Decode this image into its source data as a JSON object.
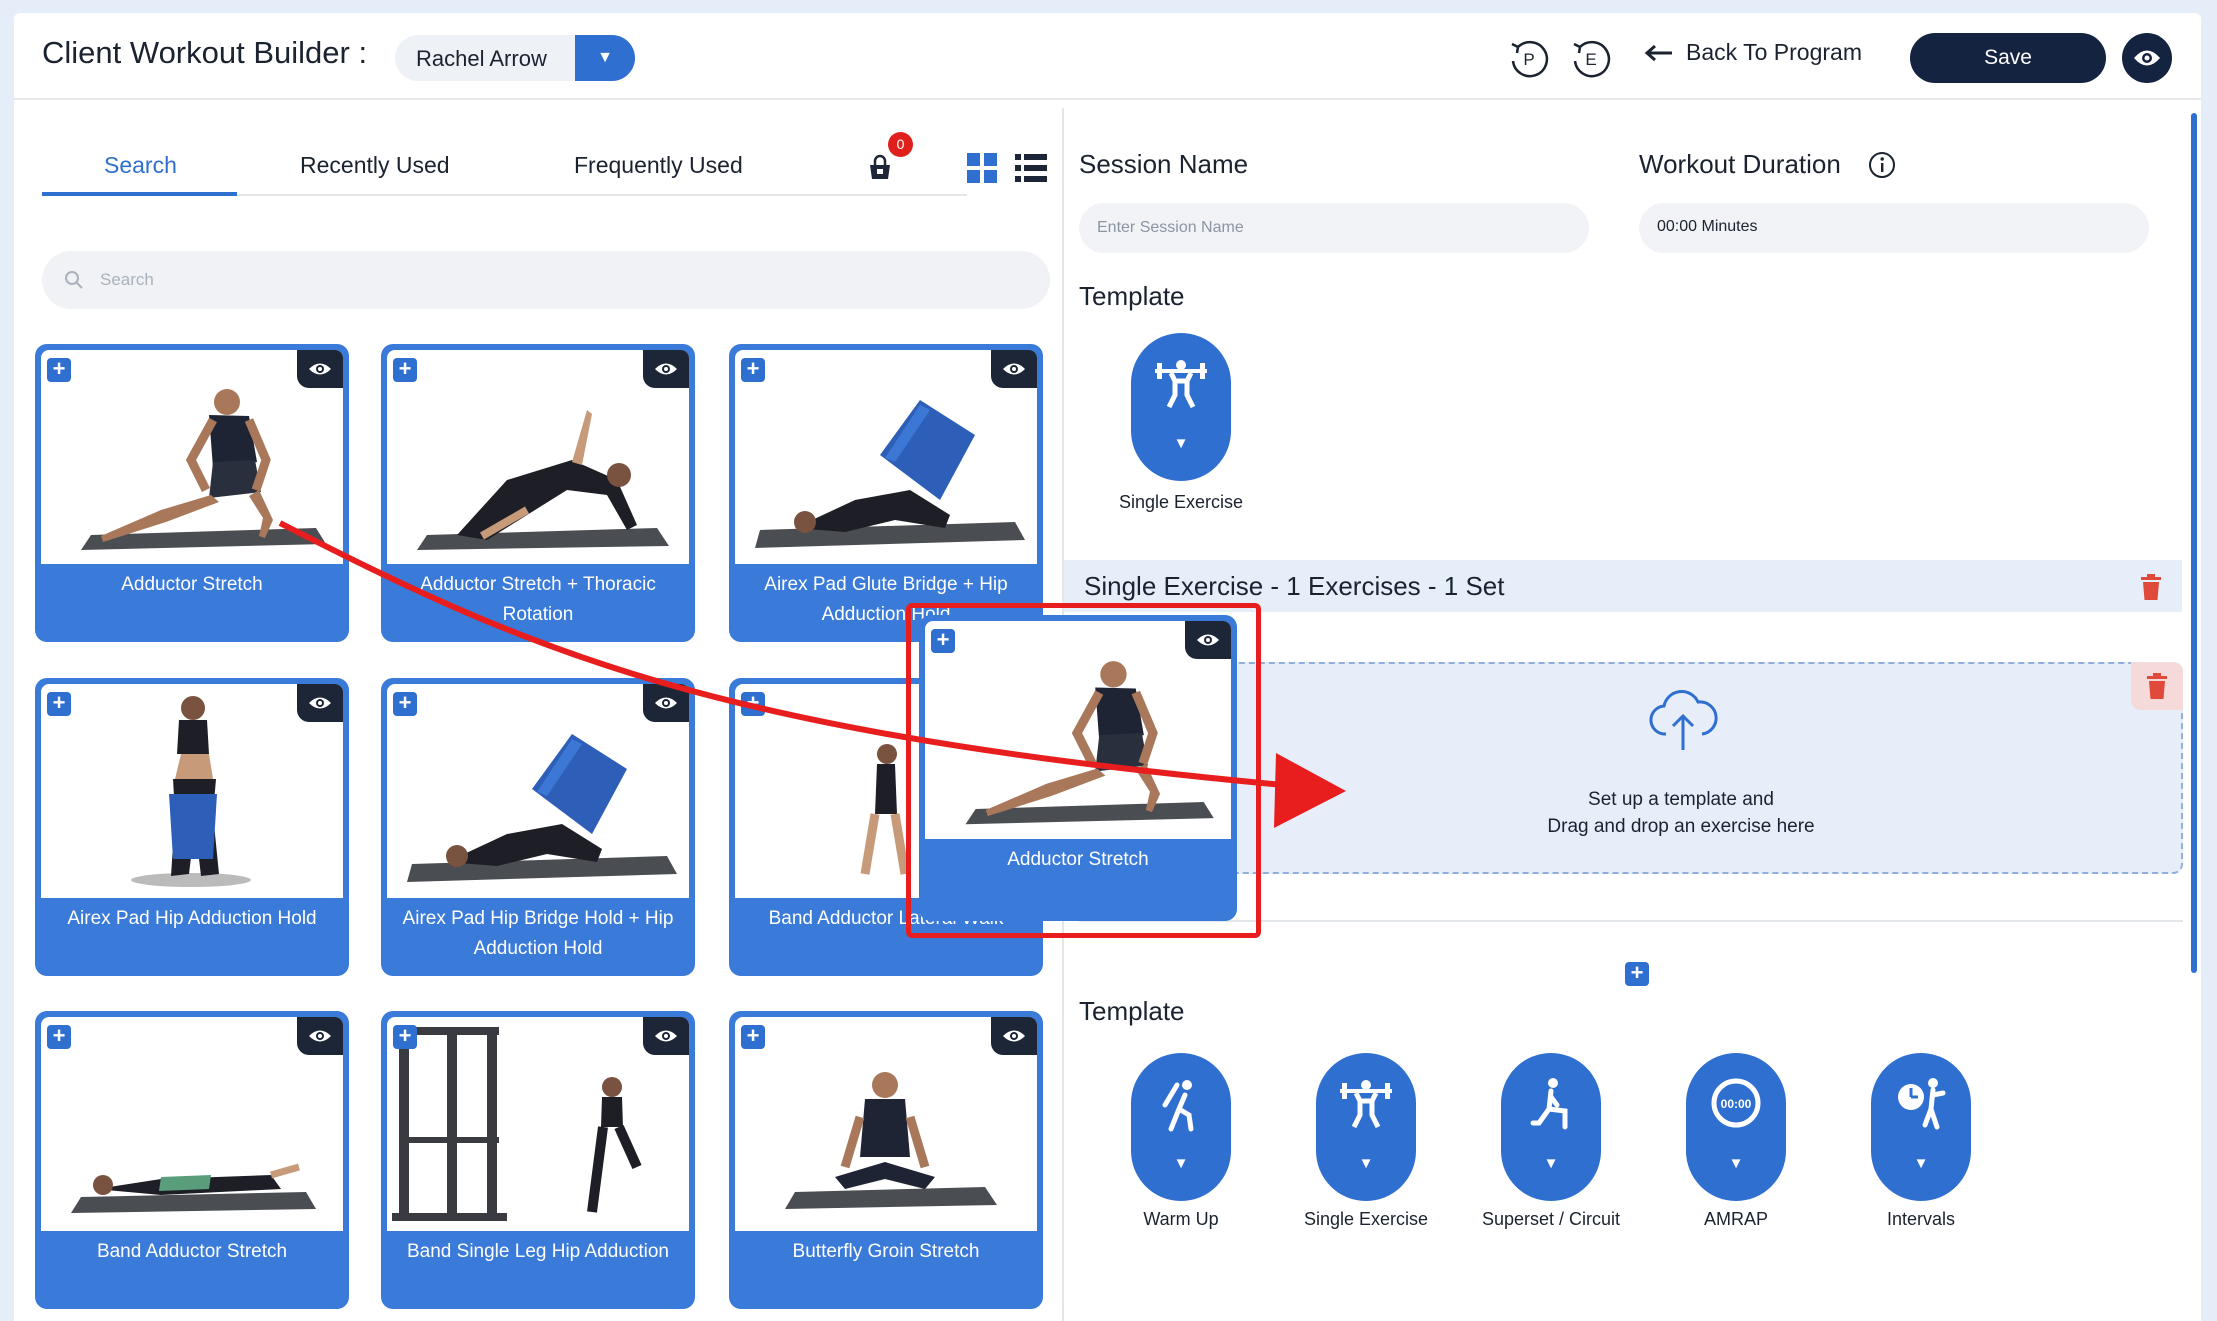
{
  "header": {
    "title": "Client Workout Builder :",
    "client_name": "Rachel Arrow",
    "undo_p": "P",
    "undo_e": "E",
    "back_label": "Back To Program",
    "save_label": "Save"
  },
  "library": {
    "tabs": [
      "Search",
      "Recently Used",
      "Frequently Used"
    ],
    "active_tab": "Search",
    "cart_count": "0",
    "search_placeholder": "Search",
    "cards": [
      {
        "label": "Adductor Stretch"
      },
      {
        "label": "Adductor Stretch + Thoracic Rotation"
      },
      {
        "label": "Airex Pad Glute Bridge + Hip Adduction Hold"
      },
      {
        "label": "Airex Pad Hip Adduction Hold"
      },
      {
        "label": "Airex Pad Hip Bridge Hold + Hip Adduction Hold"
      },
      {
        "label": "Band Adductor Lateral Walk"
      },
      {
        "label": "Band Adductor Stretch"
      },
      {
        "label": "Band Single Leg Hip Adduction"
      },
      {
        "label": "Butterfly Groin Stretch"
      }
    ],
    "dragging_card": {
      "label": "Adductor Stretch"
    }
  },
  "builder": {
    "session_name_label": "Session Name",
    "session_name_placeholder": "Enter Session Name",
    "duration_label": "Workout Duration",
    "duration_value": "00:00 Minutes",
    "template_label": "Template",
    "selected_template": "Single Exercise",
    "session_bar": "Single Exercise - 1 Exercises - 1 Set",
    "dropzone_line1": "Set up a template and",
    "dropzone_line2": "Drag and drop an exercise here",
    "template_label_2": "Template",
    "templates": [
      "Warm Up",
      "Single Exercise",
      "Superset / Circuit",
      "AMRAP",
      "Intervals"
    ],
    "amrap_icon_text": "00:00"
  },
  "colors": {
    "accent": "#2f6fd0",
    "card_bg": "#3a7ad8",
    "save_bg": "#132340",
    "annotation": "#e81e1e",
    "badge": "#e0201b"
  },
  "icons": [
    "undo-p-icon",
    "undo-e-icon",
    "arrow-left-icon",
    "eye-icon",
    "bag-icon",
    "grid-view-icon",
    "list-view-icon",
    "search-icon",
    "plus-icon",
    "trash-icon",
    "cloud-upload-icon",
    "info-icon",
    "barbell-person-icon",
    "stretch-person-icon",
    "lunge-person-icon",
    "timer-icon",
    "stopwatch-person-icon",
    "drag-arrow-annotation"
  ]
}
